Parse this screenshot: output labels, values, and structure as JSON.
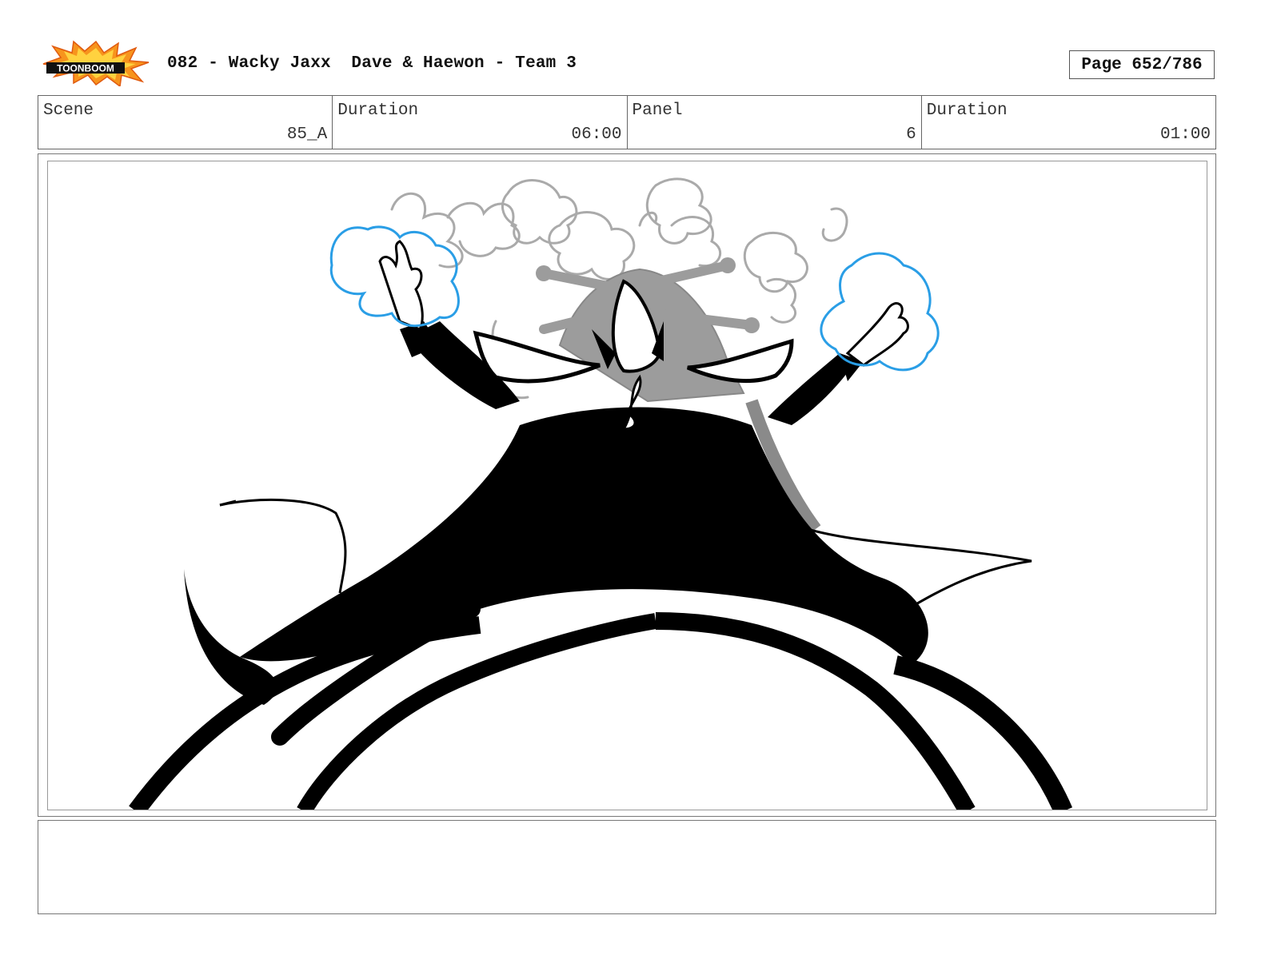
{
  "header": {
    "logo_text": "TOONBOOM",
    "title": "082 - Wacky Jaxx  Dave & Haewon - Team 3",
    "page_indicator": "Page 652/786"
  },
  "info": {
    "scene_label": "Scene",
    "scene_value": "85_A",
    "duration_label": "Duration",
    "duration_value": "06:00",
    "panel_label": "Panel",
    "panel_value": "6",
    "panel_duration_label": "Duration",
    "panel_duration_value": "01:00"
  },
  "notes": {
    "text": ""
  },
  "colors": {
    "logo_orange": "#f7941d",
    "magic_blue": "#2a9ee6",
    "smoke_gray": "#aaaaaa",
    "ink": "#000000"
  }
}
